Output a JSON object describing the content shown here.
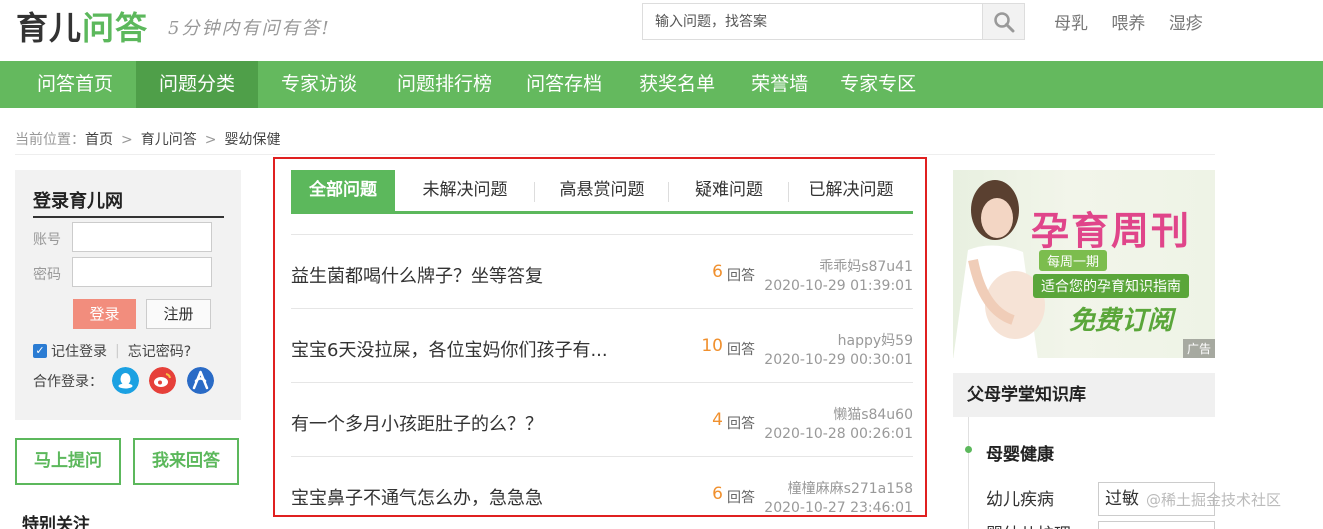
{
  "header": {
    "logo_part1": "育儿",
    "logo_part2": "问答",
    "slogan": "5分钟内有问有答!",
    "search_placeholder": "输入问题，找答案",
    "hot_links": [
      "母乳",
      "喂养",
      "湿疹"
    ]
  },
  "nav": {
    "items": [
      "问答首页",
      "问题分类",
      "专家访谈",
      "问题排行榜",
      "问答存档",
      "获奖名单",
      "荣誉墙",
      "专家专区"
    ],
    "active_index": 1
  },
  "breadcrumb": {
    "prefix": "当前位置：",
    "items": [
      "首页",
      "育儿问答",
      "婴幼保健"
    ],
    "separator": ">"
  },
  "login": {
    "title": "登录育儿网",
    "account_label": "账号",
    "password_label": "密码",
    "login_button": "登录",
    "register_button": "注册",
    "remember_label": "记住登录",
    "forgot_label": "忘记密码?",
    "coop_label": "合作登录：",
    "remember_checked": true
  },
  "actions": {
    "ask_button": "马上提问",
    "answer_button": "我来回答",
    "special_title": "特别关注"
  },
  "tabs": {
    "items": [
      "全部问题",
      "未解决问题",
      "高悬赏问题",
      "疑难问题",
      "已解决问题"
    ],
    "active_index": 0
  },
  "questions": [
    {
      "title": "益生菌都喝什么牌子？坐等答复",
      "answers": "6",
      "answers_label": "回答",
      "user": "乖乖妈s87u41",
      "time": "2020-10-29 01:39:01"
    },
    {
      "title": "宝宝6天没拉屎，各位宝妈你们孩子有...",
      "answers": "10",
      "answers_label": "回答",
      "user": "happy妈59",
      "time": "2020-10-29 00:30:01"
    },
    {
      "title": "有一个多月小孩距肚子的么？？",
      "answers": "4",
      "answers_label": "回答",
      "user": "懒猫s84u60",
      "time": "2020-10-28 00:26:01"
    },
    {
      "title": "宝宝鼻子不通气怎么办，急急急",
      "answers": "6",
      "answers_label": "回答",
      "user": "橦橦麻麻s271a158",
      "time": "2020-10-27 23:46:01"
    }
  ],
  "ad": {
    "title": "孕育周刊",
    "line1": "每周一期",
    "line2": "适合您的孕育知识指南",
    "cta": "免费订阅",
    "tag": "广告"
  },
  "knowledge": {
    "title": "父母学堂知识库",
    "section": "母婴健康",
    "item1": "幼儿疾病",
    "item1_tag": "过敏",
    "item2": "婴幼儿护理"
  },
  "watermark": "@稀土掘金技术社区",
  "colors": {
    "brand_green": "#5cb85c",
    "nav_green": "#64b95e",
    "nav_active": "#4f9f49",
    "highlight_red": "#e02020",
    "count_orange": "#f0902e",
    "login_button": "#f28d7d"
  }
}
